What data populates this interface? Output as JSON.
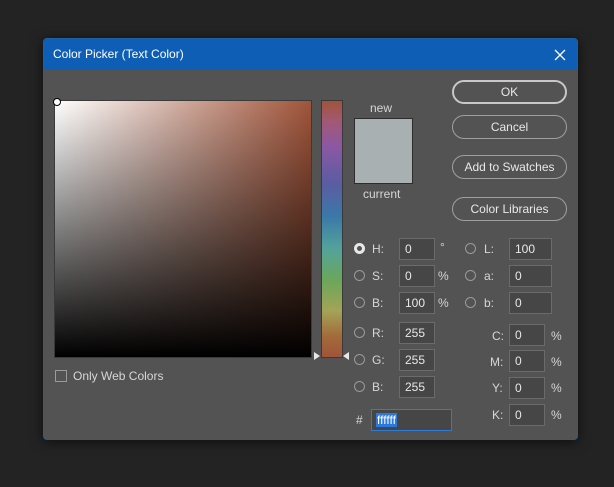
{
  "dialog": {
    "title": "Color Picker (Text Color)"
  },
  "preview": {
    "new_label": "new",
    "current_label": "current",
    "new_color": "#a9b0b2",
    "current_color": "#a9b0b2"
  },
  "buttons": {
    "ok": "OK",
    "cancel": "Cancel",
    "add_to_swatches": "Add to Swatches",
    "color_libraries": "Color Libraries"
  },
  "only_web_colors": {
    "label": "Only Web Colors",
    "checked": false
  },
  "hsb": {
    "h_label": "H:",
    "h_value": "0",
    "h_unit": "°",
    "s_label": "S:",
    "s_value": "0",
    "s_unit": "%",
    "b_label": "B:",
    "b_value": "100",
    "b_unit": "%"
  },
  "rgb": {
    "r_label": "R:",
    "r_value": "255",
    "g_label": "G:",
    "g_value": "255",
    "b_label": "B:",
    "b_value": "255"
  },
  "lab": {
    "l_label": "L:",
    "l_value": "100",
    "a_label": "a:",
    "a_value": "0",
    "b_label": "b:",
    "b_value": "0"
  },
  "cmyk": {
    "c_label": "C:",
    "c_value": "0",
    "c_unit": "%",
    "m_label": "M:",
    "m_value": "0",
    "m_unit": "%",
    "y_label": "Y:",
    "y_value": "0",
    "y_unit": "%",
    "k_label": "K:",
    "k_value": "0",
    "k_unit": "%"
  },
  "hex": {
    "label": "#",
    "value": "ffffff"
  },
  "selected_mode": "H"
}
